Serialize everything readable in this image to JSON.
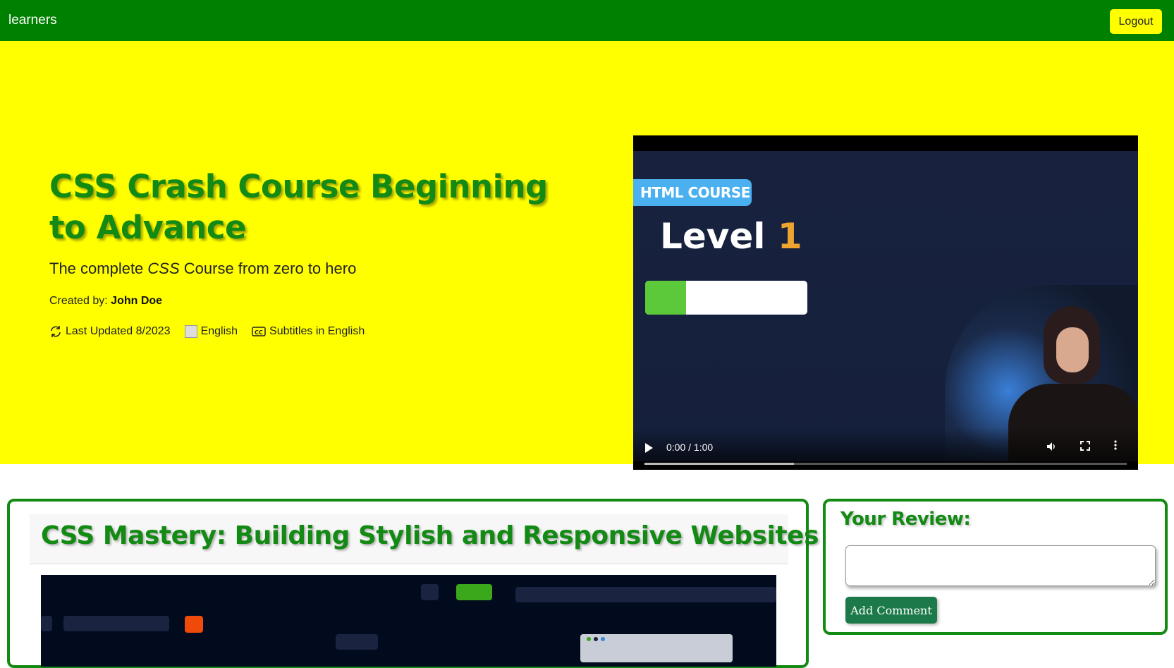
{
  "navbar": {
    "brand": "learners",
    "logout_label": "Logout"
  },
  "hero": {
    "title": "CSS Crash Course Beginning to Advance",
    "subtitle_prefix": "The complete ",
    "subtitle_em": "CSS",
    "subtitle_suffix": " Course from zero to hero",
    "created_by_label": "Created by:",
    "author": "John Doe",
    "last_updated": "Last Updated 8/2023",
    "language": "English",
    "subtitles": "Subtitles in English"
  },
  "video": {
    "badge": "HTML COURSE",
    "level_word": "Level",
    "level_num": "1",
    "level_progress": 0.25,
    "time": "0:00 / 1:00",
    "seek_fraction": 0.31
  },
  "course_card": {
    "title": "CSS Mastery: Building Stylish and Responsive Websites"
  },
  "review": {
    "title": "Your Review:",
    "placeholder": "",
    "button": "Add Comment"
  },
  "colors": {
    "navbar": "#008000",
    "hero_bg": "#ffff00",
    "title_green": "#138a13",
    "button_green": "#1c7a4a"
  }
}
